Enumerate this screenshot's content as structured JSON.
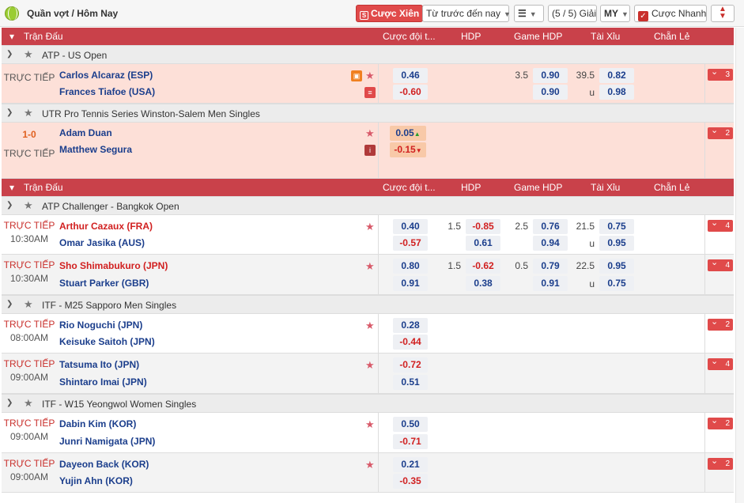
{
  "topbar": {
    "breadcrumb": "Quần vợt / Hôm Nay",
    "parlay_label": "Cược Xiên",
    "sort_label": "Từ trước đến nay",
    "count_label": "(5 / 5) Giải",
    "odds_format": "MY",
    "quick_bet_label": "Cược Nhanh"
  },
  "headers": {
    "match": "Trận Đấu",
    "ml": "Cược đội t...",
    "hdp": "HDP",
    "game_hdp": "Game HDP",
    "ou": "Tài Xỉu",
    "oe": "Chẵn Lẻ"
  },
  "live": {
    "leagues": [
      {
        "name": "ATP - US Open"
      },
      {
        "name": "UTR Pro Tennis Series Winston-Salem Men Singles"
      }
    ],
    "matches": [
      {
        "status": "TRỰC TIẾP",
        "home": "Carlos Alcaraz (ESP)",
        "away": "Frances Tiafoe (USA)",
        "ml_home": "0.46",
        "ml_away": "-0.60",
        "game_line": "3.5",
        "game_home": "0.90",
        "game_away": "0.90",
        "ou_line": "39.5",
        "ou_u": "u",
        "ou_over": "0.82",
        "ou_under": "0.98",
        "more": "3"
      },
      {
        "score": "1-0",
        "status": "TRỰC TIẾP",
        "home": "Adam Duan",
        "away": "Matthew Segura",
        "ml_home": "0.05",
        "ml_away": "-0.15",
        "more": "2"
      }
    ]
  },
  "upcoming": {
    "leagues": [
      {
        "name": "ATP Challenger - Bangkok Open"
      },
      {
        "name": "ITF - M25 Sapporo Men Singles"
      },
      {
        "name": "ITF - W15 Yeongwol Women Singles"
      }
    ],
    "matches": [
      {
        "status": "TRỰC TIẾP",
        "time": "10:30AM",
        "home": "Arthur Cazaux (FRA)",
        "away": "Omar Jasika (AUS)",
        "ml_home": "0.40",
        "ml_away": "-0.57",
        "hdp_line": "1.5",
        "hdp_home": "-0.85",
        "hdp_away": "0.61",
        "game_line": "2.5",
        "game_home": "0.76",
        "game_away": "0.94",
        "ou_line": "21.5",
        "ou_u": "u",
        "ou_over": "0.75",
        "ou_under": "0.95",
        "more": "4"
      },
      {
        "status": "TRỰC TIẾP",
        "time": "10:30AM",
        "home": "Sho Shimabukuro (JPN)",
        "away": "Stuart Parker (GBR)",
        "ml_home": "0.80",
        "ml_away": "0.91",
        "hdp_line": "1.5",
        "hdp_home": "-0.62",
        "hdp_away": "0.38",
        "game_line": "0.5",
        "game_home": "0.79",
        "game_away": "0.91",
        "ou_line": "22.5",
        "ou_u": "u",
        "ou_over": "0.95",
        "ou_under": "0.75",
        "more": "4"
      },
      {
        "status": "TRỰC TIẾP",
        "time": "08:00AM",
        "home": "Rio Noguchi (JPN)",
        "away": "Keisuke Saitoh (JPN)",
        "ml_home": "0.28",
        "ml_away": "-0.44",
        "more": "2"
      },
      {
        "status": "TRỰC TIẾP",
        "time": "09:00AM",
        "home": "Tatsuma Ito (JPN)",
        "away": "Shintaro Imai (JPN)",
        "ml_home": "-0.72",
        "ml_away": "0.51",
        "more": "4"
      },
      {
        "status": "TRỰC TIẾP",
        "time": "09:00AM",
        "home": "Dabin Kim (KOR)",
        "away": "Junri Namigata (JPN)",
        "ml_home": "0.50",
        "ml_away": "-0.71",
        "more": "2"
      },
      {
        "status": "TRỰC TIẾP",
        "time": "09:00AM",
        "home": "Dayeon Back (KOR)",
        "away": "Yujin Ahn (KOR)",
        "ml_home": "0.21",
        "ml_away": "-0.35",
        "more": "2"
      }
    ]
  },
  "colors": {
    "header": "#c9414a",
    "live_row": "#fde0d8",
    "home_red": "#d12020",
    "team_blue": "#1b3e8c"
  }
}
